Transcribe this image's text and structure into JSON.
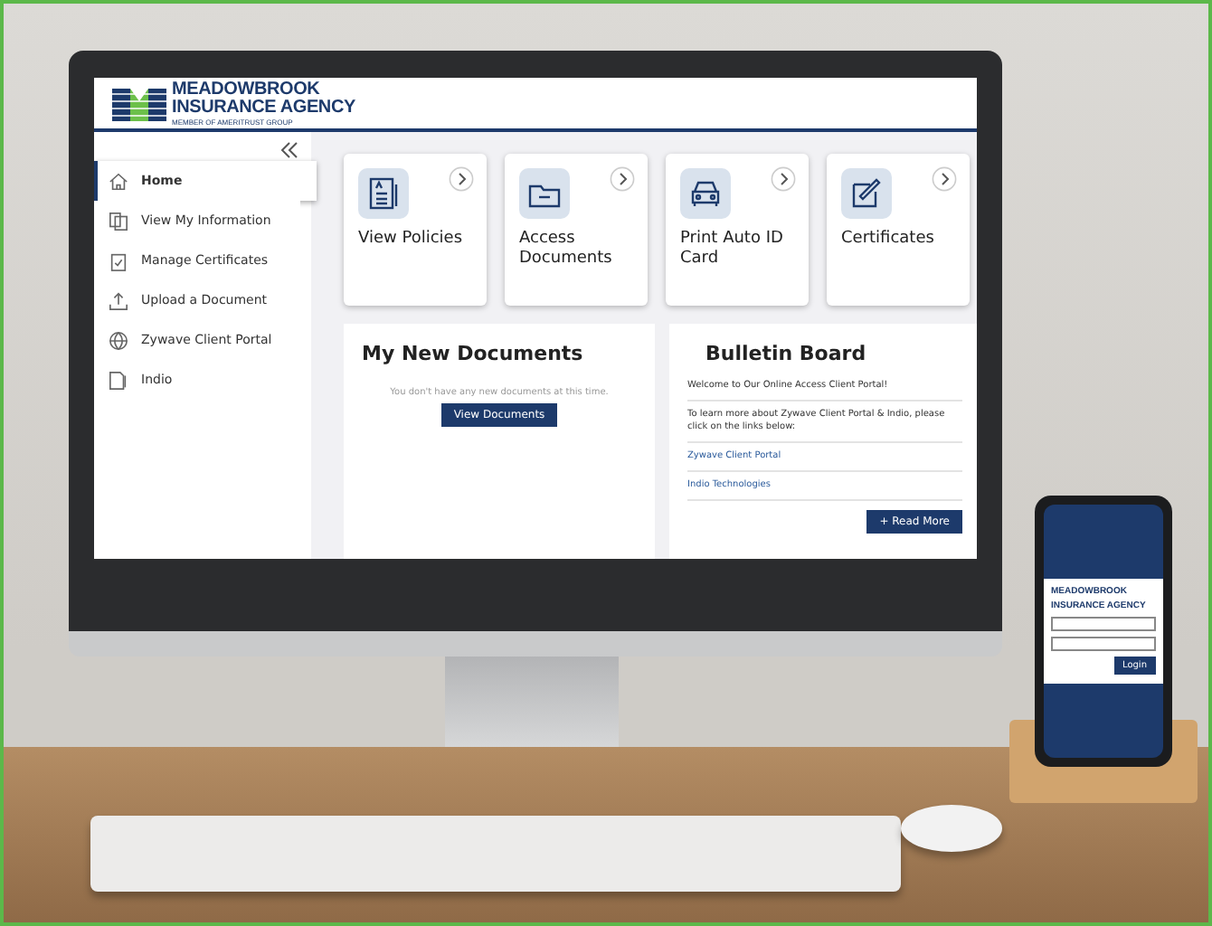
{
  "logo": {
    "line1": "MEADOWBROOK",
    "line2": "INSURANCE AGENCY",
    "tagline": "MEMBER OF AMERITRUST GROUP"
  },
  "sidebar": {
    "items": [
      {
        "label": "Home",
        "selected": true
      },
      {
        "label": "View My Information",
        "selected": false
      },
      {
        "label": "Manage Certificates",
        "selected": false
      },
      {
        "label": "Upload a Document",
        "selected": false
      },
      {
        "label": "Zywave Client Portal",
        "selected": false
      },
      {
        "label": "Indio",
        "selected": false
      }
    ]
  },
  "tiles": [
    {
      "title": "View Policies"
    },
    {
      "title": "Access Documents"
    },
    {
      "title": "Print Auto ID Card"
    },
    {
      "title": "Certificates"
    }
  ],
  "documents": {
    "title": "My New Documents",
    "message": "You don't have any new documents at this time.",
    "button": "View Documents"
  },
  "bulletin": {
    "title": "Bulletin Board",
    "entries": [
      {
        "kind": "text",
        "text": "Welcome to Our Online Access Client Portal!"
      },
      {
        "kind": "text",
        "text": "To learn more about Zywave Client Portal & Indio, please click on the links below:"
      },
      {
        "kind": "link",
        "text": "Zywave Client Portal"
      },
      {
        "kind": "link",
        "text": "Indio Technologies"
      }
    ],
    "button": "+ Read More"
  },
  "phone": {
    "line1": "MEADOWBROOK",
    "line2": "INSURANCE AGENCY",
    "button": "Login"
  }
}
